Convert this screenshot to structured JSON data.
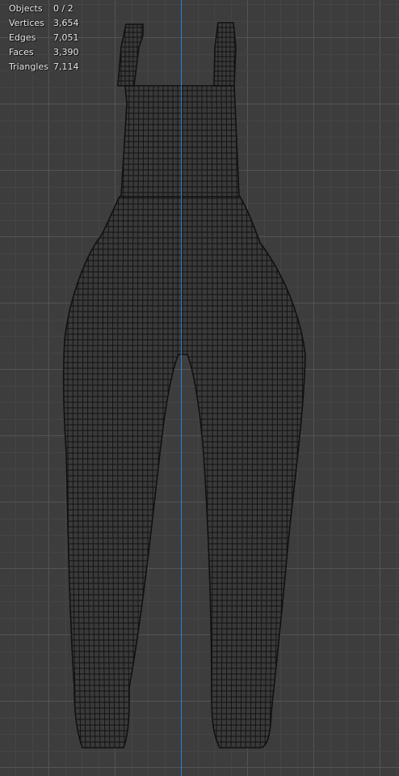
{
  "viewport": {
    "name": "3D Viewport",
    "background": "#3d3d3d",
    "grid_minor_color": "#454545",
    "grid_major_color": "#545454",
    "axis_color": "#2f7fd0",
    "wire_color": "#111111",
    "mesh_fill_color": "#3a3a3a"
  },
  "stats": [
    {
      "label": "Objects",
      "value": "0 / 2"
    },
    {
      "label": "Vertices",
      "value": "3,654"
    },
    {
      "label": "Edges",
      "value": "7,051"
    },
    {
      "label": "Faces",
      "value": "3,390"
    },
    {
      "label": "Triangles",
      "value": "7,114"
    }
  ]
}
